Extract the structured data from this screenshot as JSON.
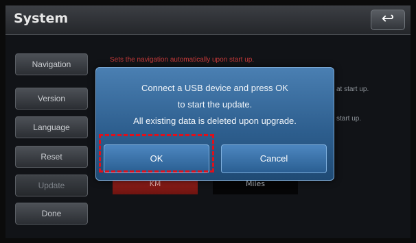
{
  "header": {
    "title": "System",
    "back_icon": "↩"
  },
  "sidebar": {
    "items": [
      {
        "label": "Navigation"
      },
      {
        "label": "Version"
      },
      {
        "label": "Language"
      },
      {
        "label": "Reset"
      },
      {
        "label": "Update"
      },
      {
        "label": "Done"
      }
    ]
  },
  "background": {
    "line1": "Sets the navigation automatically upon start up.",
    "line2": "at start up.",
    "line3": "start up.",
    "unit_km": "KM",
    "unit_miles": "Miles"
  },
  "dialog": {
    "message": [
      "Connect a USB device and press OK",
      "to start the update.",
      "All existing data is deleted upon upgrade."
    ],
    "ok_label": "OK",
    "cancel_label": "Cancel"
  },
  "colors": {
    "highlight": "#e0101b",
    "dialog": "#2e5f8f",
    "selected_unit": "#a3231f"
  }
}
